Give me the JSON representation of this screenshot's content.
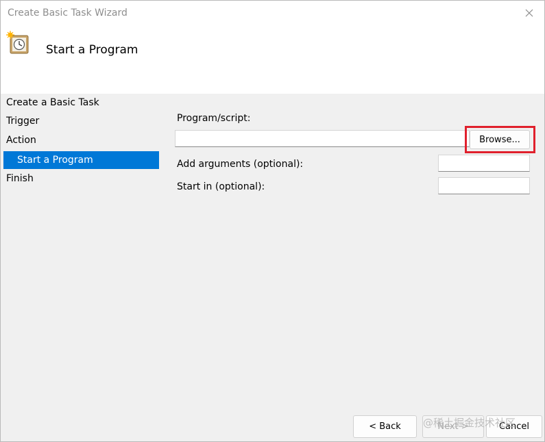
{
  "window": {
    "title": "Create Basic Task Wizard"
  },
  "header": {
    "title": "Start a Program",
    "icon": "task-clock-icon"
  },
  "sidebar": {
    "items": [
      {
        "label": "Create a Basic Task",
        "active": false
      },
      {
        "label": "Trigger",
        "active": false
      },
      {
        "label": "Action",
        "active": false
      },
      {
        "label": "Start a Program",
        "active": true
      },
      {
        "label": "Finish",
        "active": false
      }
    ]
  },
  "form": {
    "program_label": "Program/script:",
    "program_value": "",
    "browse_label": "Browse...",
    "arguments_label": "Add arguments (optional):",
    "arguments_value": "",
    "startin_label": "Start in (optional):",
    "startin_value": ""
  },
  "footer": {
    "back_label": "< Back",
    "next_label": "Next >",
    "cancel_label": "Cancel"
  },
  "watermark": "@稀土掘金技术社区",
  "colors": {
    "accent": "#0078d7",
    "highlight": "#e0202c"
  }
}
